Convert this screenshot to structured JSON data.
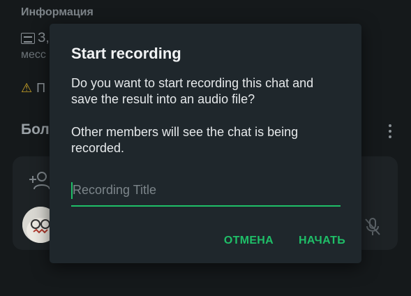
{
  "background": {
    "section_label": "Информация",
    "info_line1": "З,",
    "info_line2": "месс",
    "warning_text": "П",
    "participants_heading": "Бол"
  },
  "dialog": {
    "title": "Start recording",
    "message": "Do you want to start recording this chat and save the result into an audio file?",
    "note": "Other members will see the chat is being recorded.",
    "input_placeholder": "Recording Title",
    "input_value": "",
    "cancel_label": "ОТМЕНА",
    "start_label": "НАЧАТЬ"
  },
  "colors": {
    "accent": "#1fbf68",
    "dialog_bg": "#1f272c",
    "page_bg": "#15191b"
  },
  "icons": {
    "news": "newspaper-icon",
    "warning": "warning-icon",
    "more": "more-vertical-icon",
    "add_user": "add-user-icon",
    "mic_off": "mic-off-icon"
  }
}
